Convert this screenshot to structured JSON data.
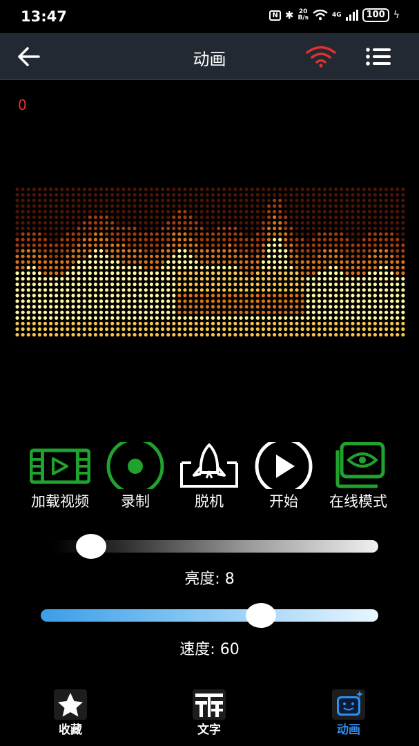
{
  "status_bar": {
    "time": "13:47",
    "net_speed_top": "20",
    "net_speed_bottom": "B/s",
    "network": "4G",
    "battery": "100"
  },
  "app_bar": {
    "title": "动画",
    "back_icon": "arrow-left-icon",
    "wifi_icon": "wifi-icon",
    "menu_icon": "list-menu-icon",
    "wifi_color": "#e0322f"
  },
  "counter": "0",
  "spectrum": {
    "colors": [
      "#fff6a0",
      "#f6c74a",
      "#d9741c",
      "#a23d0d",
      "#4a1606"
    ]
  },
  "tools": [
    {
      "label": "加载视频",
      "icon": "video-film-icon",
      "color": "#1fa32e"
    },
    {
      "label": "录制",
      "icon": "record-icon",
      "color": "#1fa32e"
    },
    {
      "label": "脱机",
      "icon": "launch-rocket-icon",
      "color": "#ffffff"
    },
    {
      "label": "开始",
      "icon": "play-icon",
      "color": "#ffffff"
    },
    {
      "label": "在线模式",
      "icon": "eye-screen-icon",
      "color": "#1fa32e"
    }
  ],
  "brightness": {
    "caption": "亮度: 8",
    "value": 8,
    "max": 100
  },
  "speed": {
    "caption": "速度: 60",
    "value": 60,
    "max": 100
  },
  "bottom_nav": [
    {
      "label": "收藏",
      "icon": "star-icon",
      "active": false
    },
    {
      "label": "文字",
      "icon": "text-icon",
      "active": false
    },
    {
      "label": "动画",
      "icon": "animation-face-icon",
      "active": true
    }
  ],
  "accent_color": "#2f8ef0"
}
